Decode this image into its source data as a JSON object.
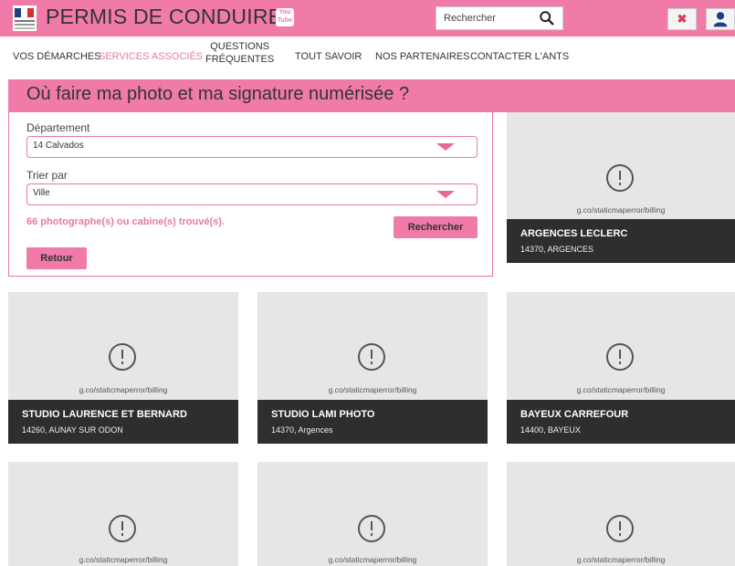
{
  "header": {
    "brand_title": "PERMIS DE CONDUIRE",
    "youtube_label": "You Tube",
    "search_placeholder": "Rechercher",
    "close_glyph": "✖"
  },
  "nav": {
    "items": [
      {
        "label": "VOS DÉMARCHES"
      },
      {
        "label": "SERVICES ASSOCIÉS",
        "active": true
      },
      {
        "label_line1": "QUESTIONS",
        "label_line2": "FRÉQUENTES"
      },
      {
        "label": "TOUT SAVOIR"
      },
      {
        "label": "NOS PARTENAIRES"
      },
      {
        "label": "CONTACTER L'ANTS"
      }
    ]
  },
  "page": {
    "title": "Où faire ma photo et ma signature numérisée ?"
  },
  "filters": {
    "departement_label": "Département",
    "departement_value": "14 Calvados",
    "sort_label": "Trier par",
    "sort_value": "Ville",
    "result_count": "66 photographe(s) ou cabine(s) trouvé(s).",
    "search_button": "Rechercher",
    "back_button": "Retour"
  },
  "map_error_text": "g.co/staticmaperror/billing",
  "cards": [
    {
      "name": "ARGENCES LECLERC",
      "address": "14370, ARGENCES"
    },
    {
      "name": "STUDIO LAURENCE ET BERNARD",
      "address": "14260, AUNAY SUR ODON"
    },
    {
      "name": "STUDIO LAMI PHOTO",
      "address": "14370, Argences"
    },
    {
      "name": "BAYEUX CARREFOUR",
      "address": "14400, BAYEUX"
    },
    {
      "name": "",
      "address": ""
    },
    {
      "name": "",
      "address": ""
    },
    {
      "name": "",
      "address": ""
    }
  ],
  "colors": {
    "brand_pink": "#f07aa8",
    "caption_dark": "#2e2e2e"
  }
}
